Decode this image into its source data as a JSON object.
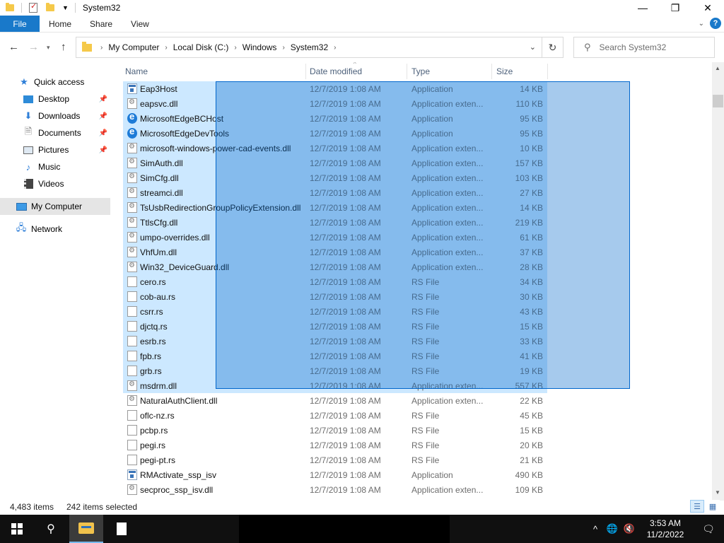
{
  "window": {
    "title": "System32"
  },
  "ribbon": {
    "tabs": [
      "File",
      "Home",
      "Share",
      "View"
    ]
  },
  "address": {
    "crumbs": [
      "My Computer",
      "Local Disk (C:)",
      "Windows",
      "System32"
    ],
    "search_placeholder": "Search System32"
  },
  "nav": {
    "quick_access": "Quick access",
    "items": [
      "Desktop",
      "Downloads",
      "Documents",
      "Pictures",
      "Music",
      "Videos"
    ],
    "my_computer": "My Computer",
    "network": "Network"
  },
  "columns": {
    "name": "Name",
    "date": "Date modified",
    "type": "Type",
    "size": "Size"
  },
  "files": [
    {
      "name": "Eap3Host",
      "date": "12/7/2019 1:08 AM",
      "type": "Application",
      "size": "14 KB",
      "icon": "app-icon",
      "selected": true
    },
    {
      "name": "eapsvc.dll",
      "date": "12/7/2019 1:08 AM",
      "type": "Application exten...",
      "size": "110 KB",
      "icon": "dll-icon",
      "selected": true
    },
    {
      "name": "MicrosoftEdgeBCHost",
      "date": "12/7/2019 1:08 AM",
      "type": "Application",
      "size": "95 KB",
      "icon": "edge-icon",
      "selected": true
    },
    {
      "name": "MicrosoftEdgeDevTools",
      "date": "12/7/2019 1:08 AM",
      "type": "Application",
      "size": "95 KB",
      "icon": "edge-icon",
      "selected": true
    },
    {
      "name": "microsoft-windows-power-cad-events.dll",
      "date": "12/7/2019 1:08 AM",
      "type": "Application exten...",
      "size": "10 KB",
      "icon": "dll-icon",
      "selected": true
    },
    {
      "name": "SimAuth.dll",
      "date": "12/7/2019 1:08 AM",
      "type": "Application exten...",
      "size": "157 KB",
      "icon": "dll-icon",
      "selected": true
    },
    {
      "name": "SimCfg.dll",
      "date": "12/7/2019 1:08 AM",
      "type": "Application exten...",
      "size": "103 KB",
      "icon": "dll-icon",
      "selected": true
    },
    {
      "name": "streamci.dll",
      "date": "12/7/2019 1:08 AM",
      "type": "Application exten...",
      "size": "27 KB",
      "icon": "dll-icon",
      "selected": true
    },
    {
      "name": "TsUsbRedirectionGroupPolicyExtension.dll",
      "date": "12/7/2019 1:08 AM",
      "type": "Application exten...",
      "size": "14 KB",
      "icon": "dll-icon",
      "selected": true
    },
    {
      "name": "TtlsCfg.dll",
      "date": "12/7/2019 1:08 AM",
      "type": "Application exten...",
      "size": "219 KB",
      "icon": "dll-icon",
      "selected": true
    },
    {
      "name": "umpo-overrides.dll",
      "date": "12/7/2019 1:08 AM",
      "type": "Application exten...",
      "size": "61 KB",
      "icon": "dll-icon",
      "selected": true
    },
    {
      "name": "VhfUm.dll",
      "date": "12/7/2019 1:08 AM",
      "type": "Application exten...",
      "size": "37 KB",
      "icon": "dll-icon",
      "selected": true
    },
    {
      "name": "Win32_DeviceGuard.dll",
      "date": "12/7/2019 1:08 AM",
      "type": "Application exten...",
      "size": "28 KB",
      "icon": "dll-icon",
      "selected": true
    },
    {
      "name": "cero.rs",
      "date": "12/7/2019 1:08 AM",
      "type": "RS File",
      "size": "34 KB",
      "icon": "file-icon",
      "selected": true
    },
    {
      "name": "cob-au.rs",
      "date": "12/7/2019 1:08 AM",
      "type": "RS File",
      "size": "30 KB",
      "icon": "file-icon",
      "selected": true
    },
    {
      "name": "csrr.rs",
      "date": "12/7/2019 1:08 AM",
      "type": "RS File",
      "size": "43 KB",
      "icon": "file-icon",
      "selected": true
    },
    {
      "name": "djctq.rs",
      "date": "12/7/2019 1:08 AM",
      "type": "RS File",
      "size": "15 KB",
      "icon": "file-icon",
      "selected": true
    },
    {
      "name": "esrb.rs",
      "date": "12/7/2019 1:08 AM",
      "type": "RS File",
      "size": "33 KB",
      "icon": "file-icon",
      "selected": true
    },
    {
      "name": "fpb.rs",
      "date": "12/7/2019 1:08 AM",
      "type": "RS File",
      "size": "41 KB",
      "icon": "file-icon",
      "selected": true
    },
    {
      "name": "grb.rs",
      "date": "12/7/2019 1:08 AM",
      "type": "RS File",
      "size": "19 KB",
      "icon": "file-icon",
      "selected": true
    },
    {
      "name": "msdrm.dll",
      "date": "12/7/2019 1:08 AM",
      "type": "Application exten...",
      "size": "557 KB",
      "icon": "dll-icon",
      "selected": true
    },
    {
      "name": "NaturalAuthClient.dll",
      "date": "12/7/2019 1:08 AM",
      "type": "Application exten...",
      "size": "22 KB",
      "icon": "dll-icon",
      "selected": false
    },
    {
      "name": "oflc-nz.rs",
      "date": "12/7/2019 1:08 AM",
      "type": "RS File",
      "size": "45 KB",
      "icon": "file-icon",
      "selected": false
    },
    {
      "name": "pcbp.rs",
      "date": "12/7/2019 1:08 AM",
      "type": "RS File",
      "size": "15 KB",
      "icon": "file-icon",
      "selected": false
    },
    {
      "name": "pegi.rs",
      "date": "12/7/2019 1:08 AM",
      "type": "RS File",
      "size": "20 KB",
      "icon": "file-icon",
      "selected": false
    },
    {
      "name": "pegi-pt.rs",
      "date": "12/7/2019 1:08 AM",
      "type": "RS File",
      "size": "21 KB",
      "icon": "file-icon",
      "selected": false
    },
    {
      "name": "RMActivate_ssp_isv",
      "date": "12/7/2019 1:08 AM",
      "type": "Application",
      "size": "490 KB",
      "icon": "app-icon",
      "selected": false
    },
    {
      "name": "secproc_ssp_isv.dll",
      "date": "12/7/2019 1:08 AM",
      "type": "Application exten...",
      "size": "109 KB",
      "icon": "dll-icon",
      "selected": false
    }
  ],
  "status": {
    "count": "4,483 items",
    "selected": "242 items selected"
  },
  "taskbar": {
    "time": "3:53 AM",
    "date": "11/2/2022"
  },
  "colors": {
    "accent": "#1979ca",
    "selection": "#cce8ff",
    "marquee": "#0066cc"
  }
}
